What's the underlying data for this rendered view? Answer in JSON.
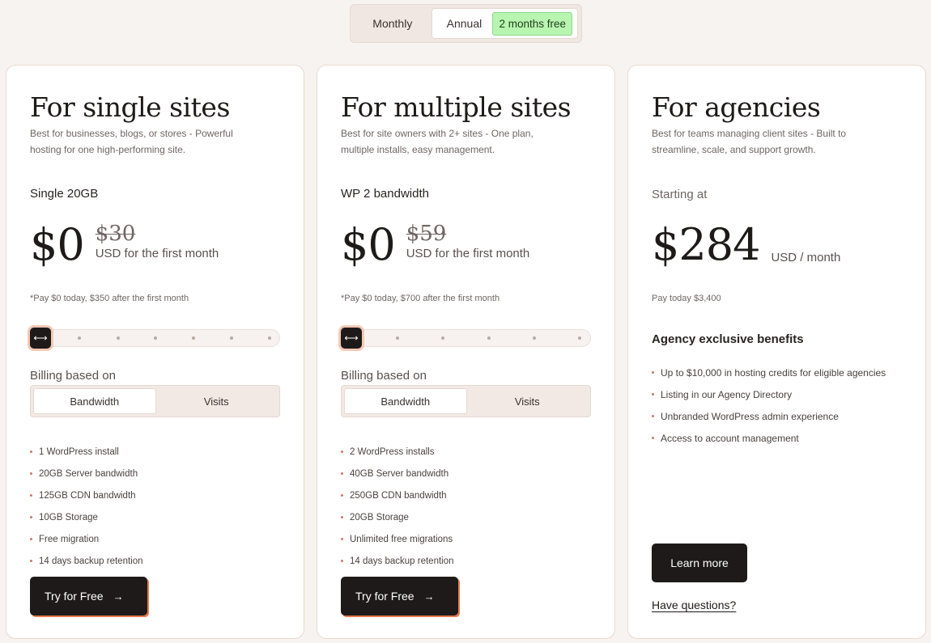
{
  "period_toggle": {
    "monthly": "Monthly",
    "annual": "Annual",
    "badge": "2 months free",
    "selected": "Annual"
  },
  "plans": [
    {
      "title": "For single sites",
      "description": "Best for businesses, blogs, or stores - Powerful hosting for one high-performing site.",
      "plan_name": "Single 20GB",
      "price": "$0",
      "old_price": "$30",
      "price_unit": "USD for the first month",
      "pay_note": "*Pay $0 today, $350 after the first month",
      "slider_position": 0,
      "billing_label": "Billing based on",
      "billing_options": [
        "Bandwidth",
        "Visits"
      ],
      "billing_selected": "Bandwidth",
      "features": [
        "1 WordPress install",
        "20GB Server bandwidth",
        "125GB CDN bandwidth",
        "10GB Storage",
        "Free migration",
        "14 days backup retention"
      ],
      "cta": "Try for Free",
      "cta_icon": "arrow-right-icon"
    },
    {
      "title": "For multiple sites",
      "description": "Best for site owners with 2+ sites - One plan, multiple installs, easy management.",
      "plan_name": "WP 2 bandwidth",
      "price": "$0",
      "old_price": "$59",
      "price_unit": "USD for the first month",
      "pay_note": "*Pay $0 today, $700 after the first month",
      "slider_position": 0,
      "billing_label": "Billing based on",
      "billing_options": [
        "Bandwidth",
        "Visits"
      ],
      "billing_selected": "Bandwidth",
      "features": [
        "2 WordPress installs",
        "40GB Server bandwidth",
        "250GB CDN bandwidth",
        "20GB Storage",
        "Unlimited free migrations",
        "14 days backup retention"
      ],
      "cta": "Try for Free",
      "cta_icon": "arrow-right-icon"
    },
    {
      "title": "For agencies",
      "description": "Best for teams managing client sites - Built to streamline, scale, and support growth.",
      "starting_label": "Starting at",
      "price": "$284",
      "price_unit": "USD / month",
      "pay_note": "Pay today $3,400",
      "benefits_title": "Agency exclusive benefits",
      "benefits": [
        "Up to $10,000 in hosting credits for eligible agencies",
        "Listing in our Agency Directory",
        "Unbranded WordPress admin experience",
        "Access to account management"
      ],
      "cta": "Learn more",
      "secondary_link": "Have questions?"
    }
  ],
  "colors": {
    "background": "#f7f3f0",
    "card": "#ffffff",
    "dark_button": "#1e1a19",
    "accent_orange": "#e67a4e",
    "badge_green": "#b8f5b0"
  }
}
